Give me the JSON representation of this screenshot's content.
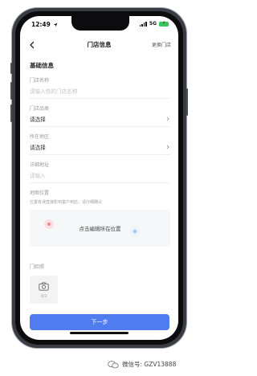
{
  "status": {
    "time": "12:49",
    "network": "5G"
  },
  "nav": {
    "title": "门店信息",
    "action": "更换门店"
  },
  "form": {
    "section_title": "基础信息",
    "store_name": {
      "label": "门店名称",
      "placeholder": "请输入你的门店名称"
    },
    "store_type": {
      "label": "门店品类",
      "value": "请选择"
    },
    "region": {
      "label": "所在地区",
      "value": "请选择"
    },
    "address": {
      "label": "详细地址",
      "placeholder": "请输入"
    },
    "map": {
      "label": "地图位置",
      "hint": "位置有误直接影响客户到店，请仔细确认",
      "caption": "点击编辑所在位置"
    },
    "photo": {
      "label": "门脸照",
      "count": "0/3"
    }
  },
  "footer": {
    "next_label": "下一步"
  },
  "watermark": {
    "text": "微信号: GZV13888"
  },
  "colors": {
    "primary": "#4f7df0",
    "battery": "#35c759"
  }
}
